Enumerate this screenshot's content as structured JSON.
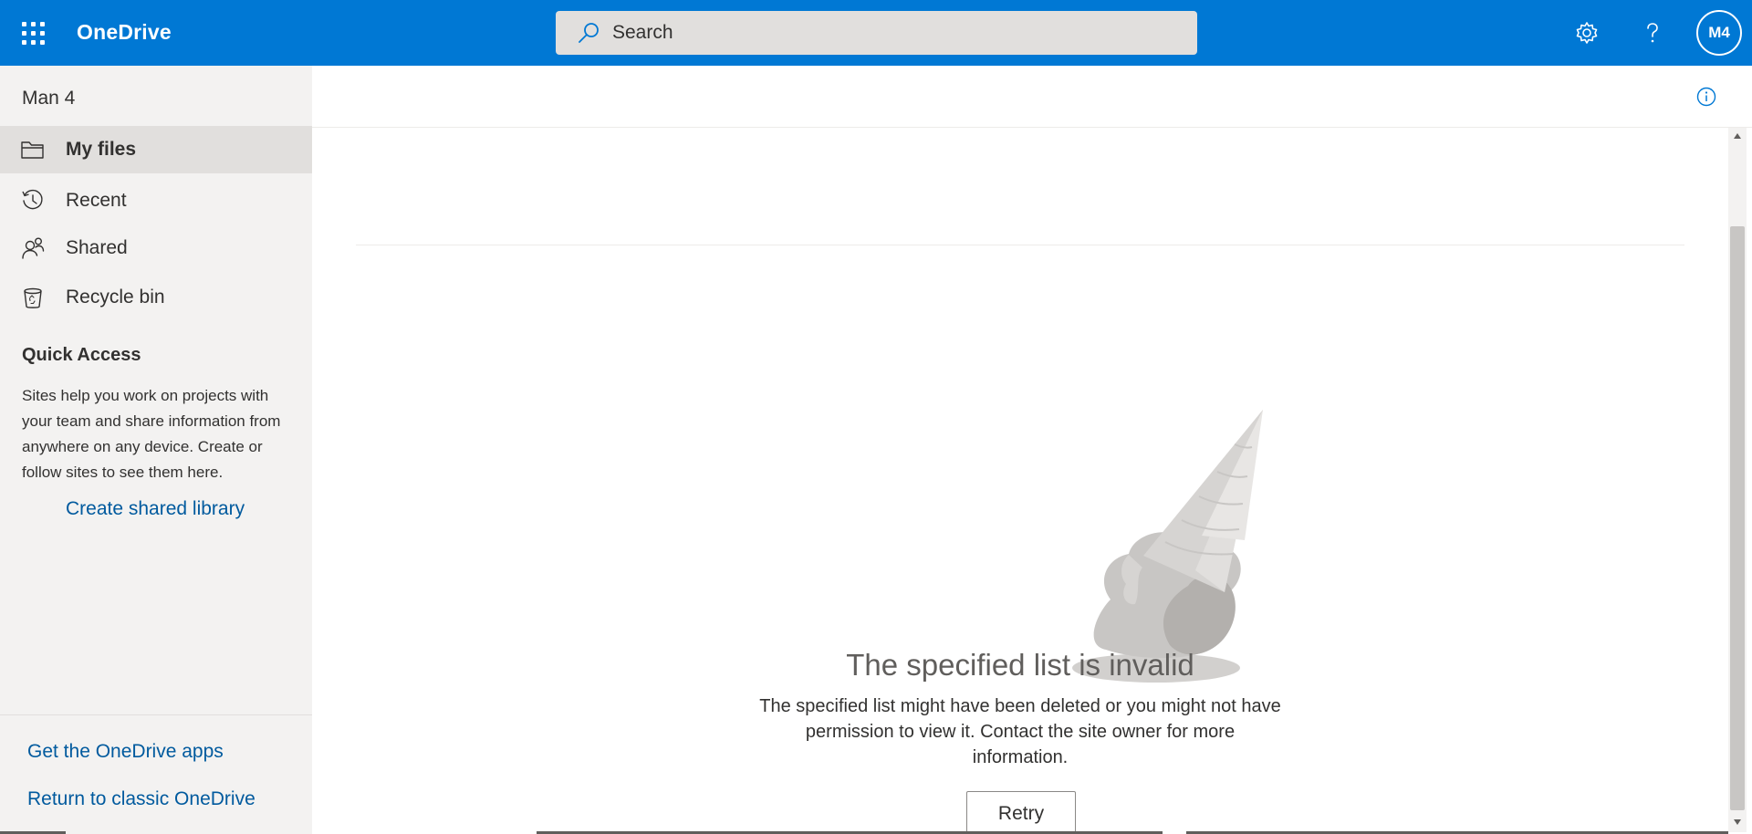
{
  "header": {
    "app_name": "OneDrive",
    "search_placeholder": "Search",
    "avatar_initials": "M4",
    "brand_color": "#0078d4"
  },
  "sidebar": {
    "user_name": "Man 4",
    "items": [
      {
        "label": "My files",
        "icon": "folder-icon",
        "active": true
      },
      {
        "label": "Recent",
        "icon": "history-icon",
        "active": false
      },
      {
        "label": "Shared",
        "icon": "people-icon",
        "active": false
      },
      {
        "label": "Recycle bin",
        "icon": "recycle-bin-icon",
        "active": false
      }
    ],
    "quick_access": {
      "title": "Quick Access",
      "description": "Sites help you work on projects with your team and share information from anywhere on any device. Create or follow sites to see them here.",
      "create_link": "Create shared library"
    },
    "footer_links": [
      "Get the OneDrive apps",
      "Return to classic OneDrive"
    ]
  },
  "main": {
    "error_title": "The specified list is invalid",
    "error_description": "The specified list might have been deleted or you might not have permission to view it. Contact the site owner for more information.",
    "retry_label": "Retry",
    "illustration": "dropped-ice-cream-cone"
  }
}
